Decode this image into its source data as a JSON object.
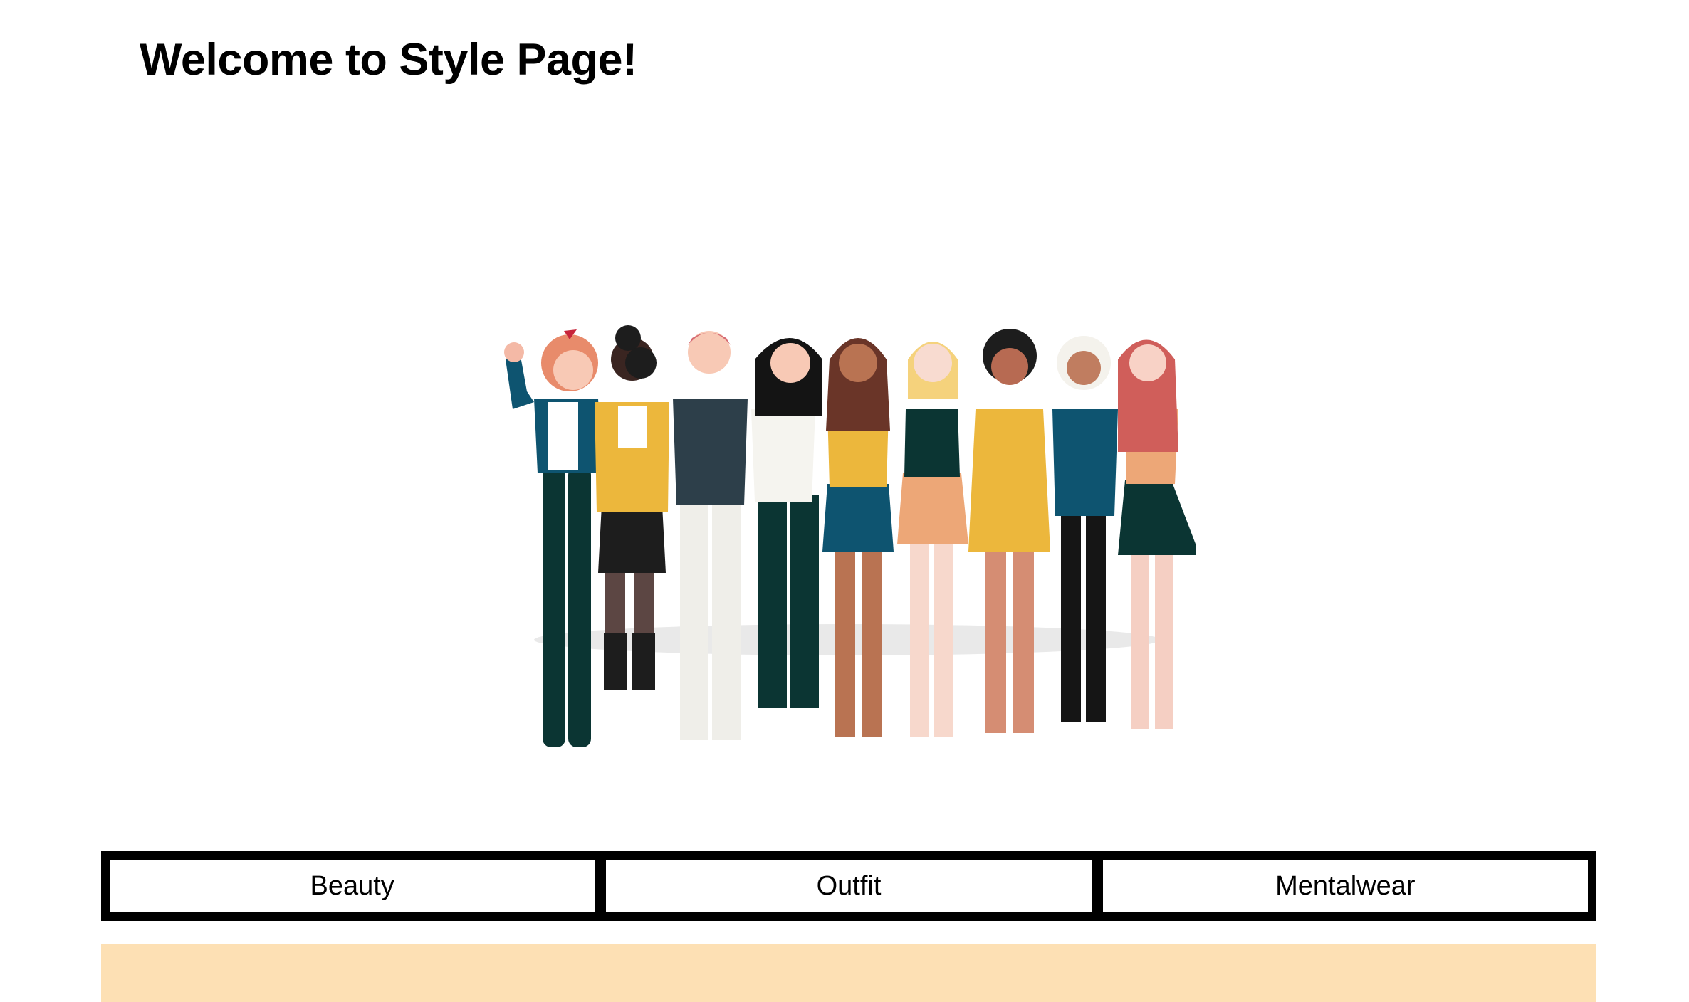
{
  "page": {
    "title": "Welcome to Style Page!"
  },
  "hero": {
    "image_description_icon": "group-of-women-illustration",
    "palette": {
      "yellow": "#ecb73c",
      "teal": "#0e5470",
      "dark_green": "#0b3533",
      "peach": "#eda777",
      "red_hair": "#d05e5a"
    }
  },
  "tabs": [
    {
      "label": "Beauty"
    },
    {
      "label": "Outfit"
    },
    {
      "label": "Mentalwear"
    }
  ],
  "colors": {
    "banner": "#fde0b4",
    "tab_border": "#000000"
  }
}
